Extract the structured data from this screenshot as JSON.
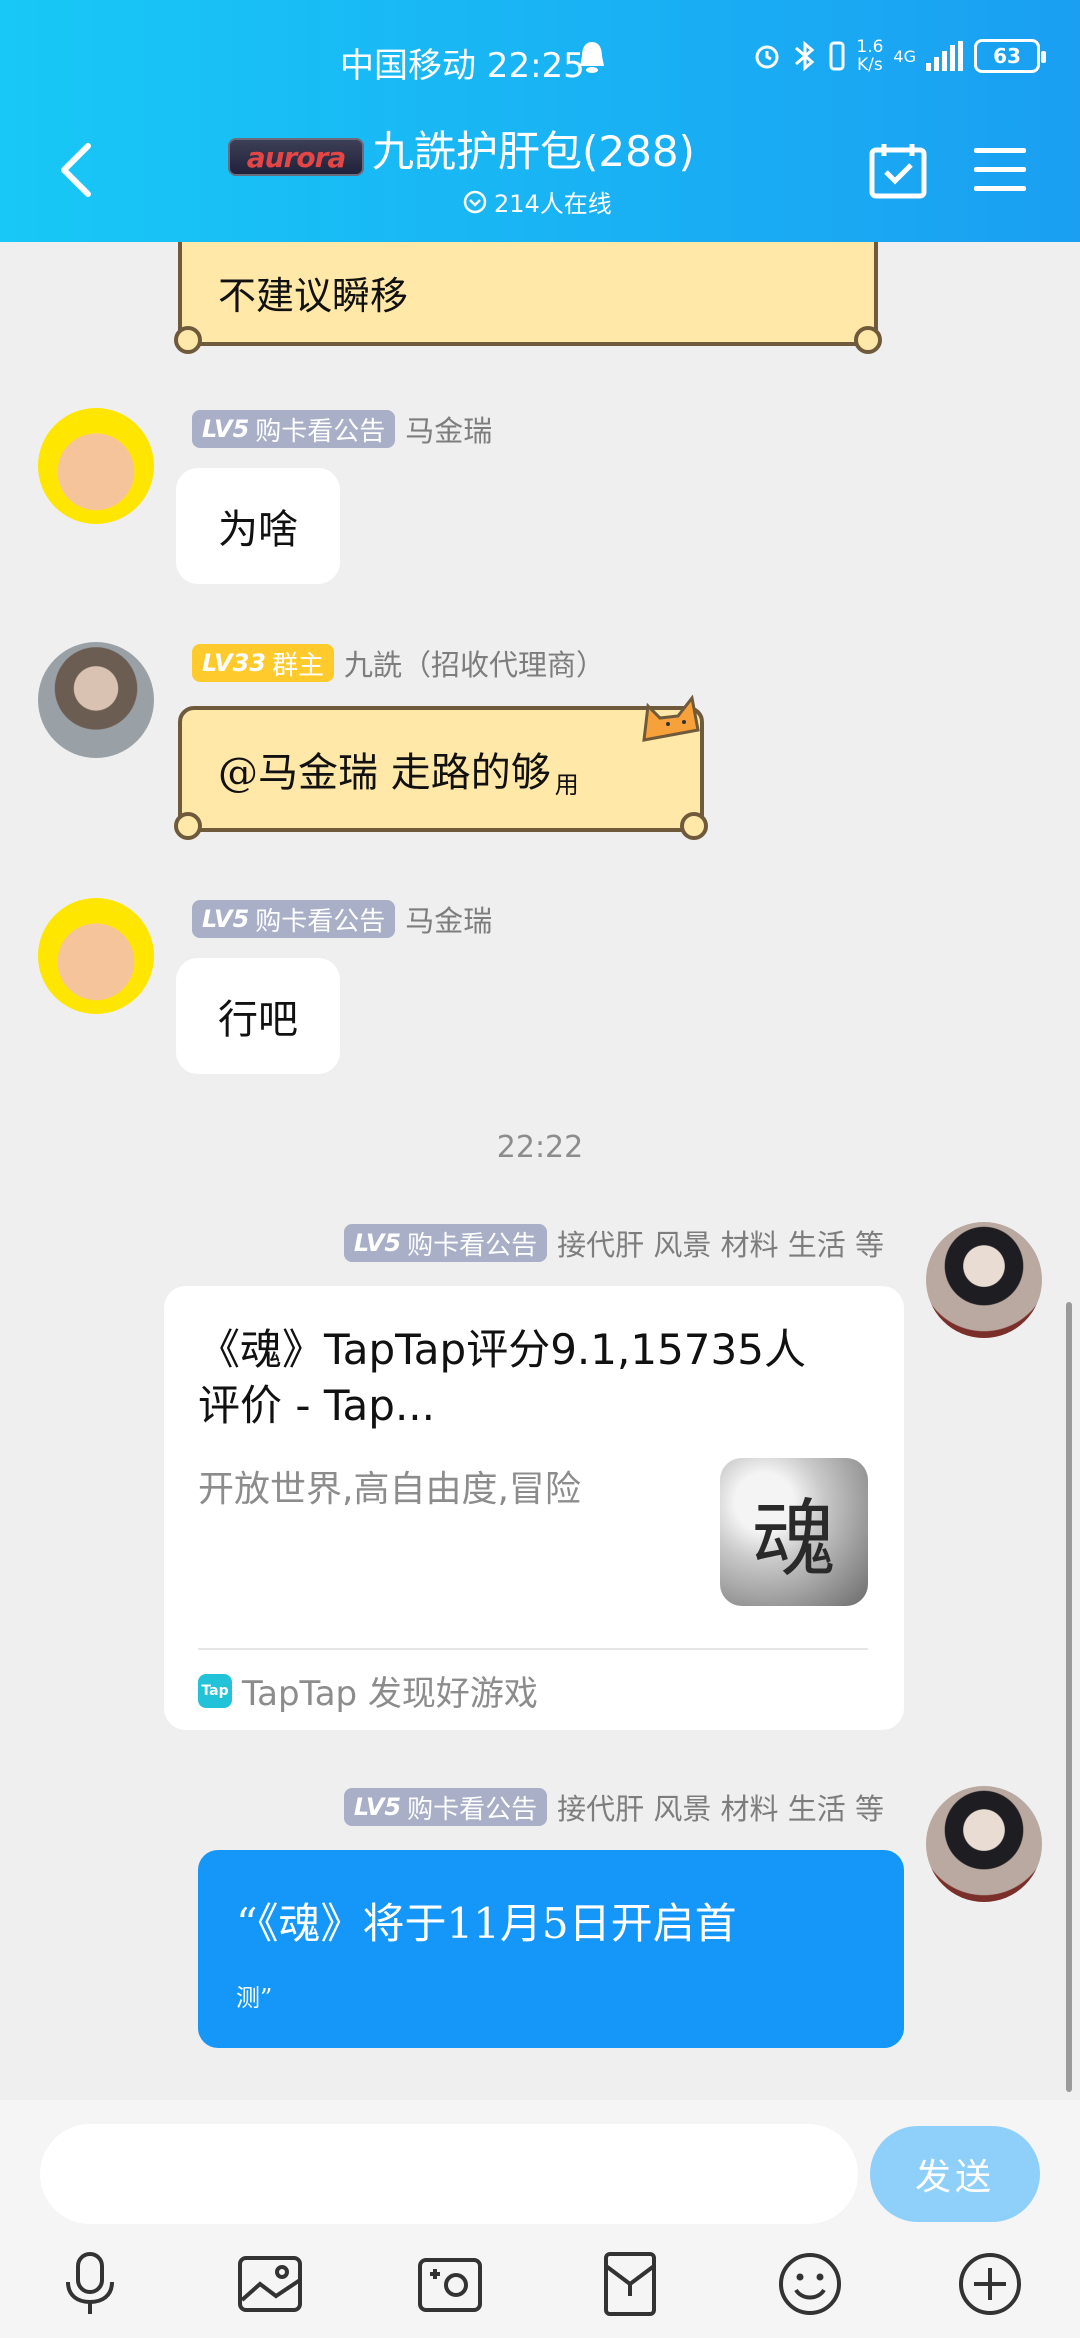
{
  "status_bar": {
    "carrier_time": "中国移动 22:25",
    "speed_top": "1.6",
    "speed_bottom": "K/s",
    "network": "4G",
    "battery": "63"
  },
  "header": {
    "logo_text": "aurora",
    "group_name": "九詵护肝包(288)",
    "online_count": "214人在线",
    "bg_color": "#19b2f4"
  },
  "messages": [
    {
      "type": "parchment",
      "text": "不建议瞬移"
    },
    {
      "badge": "LV5",
      "badge_title": "购卡看公告",
      "sender": "马金瑞",
      "text": "为啥"
    },
    {
      "badge": "LV33",
      "badge_title": "群主",
      "sender": "九詵（招收代理商）",
      "text_main": "@马金瑞 走路的够",
      "text_small": "用"
    },
    {
      "badge": "LV5",
      "badge_title": "购卡看公告",
      "sender": "马金瑞",
      "text": "行吧"
    }
  ],
  "timestamp": "22:22",
  "share": {
    "badge": "LV5",
    "badge_title": "购卡看公告",
    "sender": "接代肝 风景 材料 生活 等",
    "title": "《魂》TapTap评分9.1,15735人评价 - Tap...",
    "desc": "开放世界,高自由度,冒险",
    "thumb_char": "魂",
    "source_icon": "Tap",
    "source": "TapTap 发现好游戏"
  },
  "last": {
    "badge": "LV5",
    "badge_title": "购卡看公告",
    "sender": "接代肝 风景 材料 生活 等",
    "line1": "“《魂》将于11月5日开启首",
    "line2": "测”"
  },
  "input": {
    "placeholder": "",
    "send_label": "发送"
  },
  "toolbar": [
    "mic-icon",
    "image-icon",
    "camera-icon",
    "red-packet-icon",
    "emoji-icon",
    "plus-icon"
  ]
}
